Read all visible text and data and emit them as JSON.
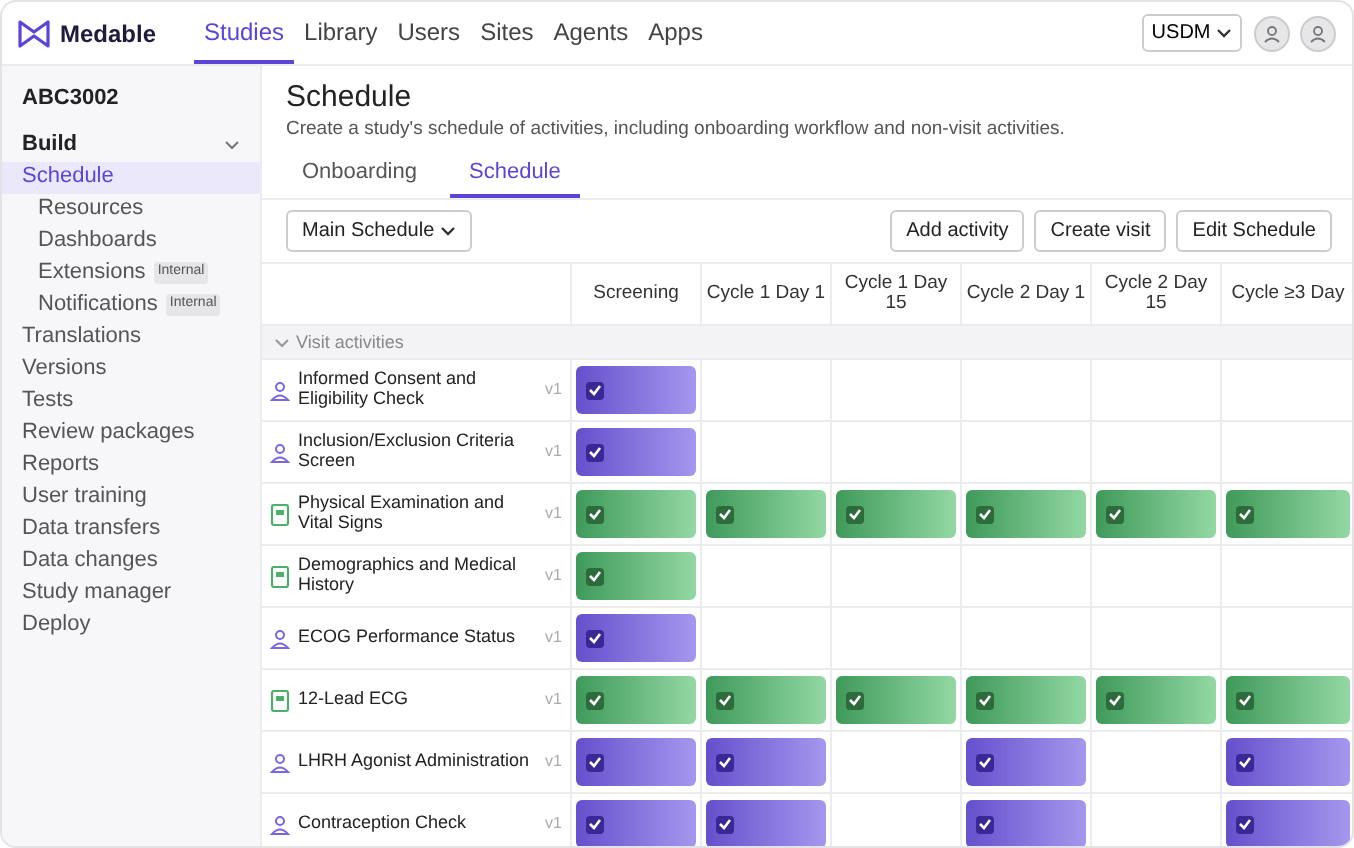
{
  "brand": "Medable",
  "nav": [
    {
      "label": "Studies",
      "selected": true
    },
    {
      "label": "Library",
      "selected": false
    },
    {
      "label": "Users",
      "selected": false
    },
    {
      "label": "Sites",
      "selected": false
    },
    {
      "label": "Agents",
      "selected": false
    },
    {
      "label": "Apps",
      "selected": false
    }
  ],
  "standard": "USDM",
  "sidebar": {
    "project": "ABC3002",
    "section": {
      "label": "Build",
      "expanded": true
    },
    "items": [
      {
        "label": "Schedule",
        "selected": true,
        "children": [
          {
            "label": "Resources",
            "selected": false
          },
          {
            "label": "Dashboards",
            "selected": false
          },
          {
            "label": "Extensions",
            "badge": "Internal",
            "selected": false
          },
          {
            "label": "Notifications",
            "badge": "Internal",
            "selected": false
          }
        ]
      },
      {
        "label": "Translations",
        "selected": false
      },
      {
        "label": "Versions",
        "selected": false
      },
      {
        "label": "Tests",
        "selected": false
      },
      {
        "label": "Review packages",
        "selected": false
      },
      {
        "label": "Reports",
        "selected": false
      },
      {
        "label": "User training",
        "selected": false
      },
      {
        "label": "Data transfers",
        "selected": false
      },
      {
        "label": "Data changes",
        "selected": false
      },
      {
        "label": "Study manager",
        "selected": false
      },
      {
        "label": "Deploy",
        "selected": false
      }
    ]
  },
  "page": {
    "title": "Schedule",
    "subtitle": "Create a study's schedule of activities, including onboarding workflow and non-visit activities.",
    "tabs": [
      {
        "label": "Onboarding",
        "selected": false
      },
      {
        "label": "Schedule",
        "selected": true
      }
    ],
    "schedule_select": "Main Schedule",
    "actions": [
      "Add activity",
      "Create visit",
      "Edit Schedule"
    ]
  },
  "table": {
    "columns": [
      "Screening",
      "Cycle 1 Day 1",
      "Cycle 1 Day 15",
      "Cycle 2 Day 1",
      "Cycle 2 Day 15",
      "Cycle ≥3 Day"
    ],
    "group": {
      "label": "Visit activities",
      "expanded": true
    },
    "rows": [
      {
        "name": "Informed Consent and Eligibility Check",
        "kind": "participant",
        "version": "v1",
        "cells": [
          true,
          false,
          false,
          false,
          false,
          false
        ]
      },
      {
        "name": "Inclusion/Exclusion Criteria Screen",
        "kind": "participant",
        "version": "v1",
        "cells": [
          true,
          false,
          false,
          false,
          false,
          false
        ]
      },
      {
        "name": "Physical Examination and Vital Signs",
        "kind": "form",
        "version": "v1",
        "cells": [
          true,
          true,
          true,
          true,
          true,
          true
        ]
      },
      {
        "name": "Demographics and Medical History",
        "kind": "form",
        "version": "v1",
        "cells": [
          true,
          false,
          false,
          false,
          false,
          false
        ]
      },
      {
        "name": "ECOG Performance Status",
        "kind": "participant",
        "version": "v1",
        "cells": [
          true,
          false,
          false,
          false,
          false,
          false
        ]
      },
      {
        "name": "12-Lead ECG",
        "kind": "form",
        "version": "v1",
        "cells": [
          true,
          true,
          true,
          true,
          true,
          true
        ]
      },
      {
        "name": "LHRH Agonist Administration",
        "kind": "participant",
        "version": "v1",
        "cells": [
          true,
          true,
          false,
          true,
          false,
          true
        ]
      },
      {
        "name": "Contraception Check",
        "kind": "participant",
        "version": "v1",
        "cells": [
          true,
          true,
          false,
          true,
          false,
          true
        ]
      }
    ]
  }
}
